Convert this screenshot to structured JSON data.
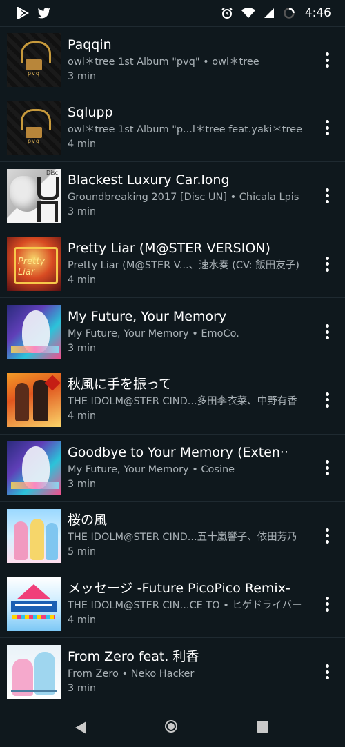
{
  "status_bar": {
    "time": "4:46",
    "left_icons": [
      "play-store-icon",
      "twitter-icon"
    ],
    "right_icons": [
      "alarm-icon",
      "wifi-icon",
      "signal-icon",
      "loading-icon"
    ]
  },
  "tracks": [
    {
      "title": "Paqqin",
      "subtitle": "owl＊tree 1st Album \"pvq\" • owl＊tree",
      "duration": "3 min",
      "art": "owl"
    },
    {
      "title": "Sqlupp",
      "subtitle": "owl＊tree 1st Album \"p...l＊tree feat.yaki＊tree",
      "duration": "4 min",
      "art": "owl"
    },
    {
      "title": "Blackest Luxury Car.long",
      "subtitle": "Groundbreaking 2017 [Disc UN] • Chicala Lpis",
      "duration": "3 min",
      "art": "gb"
    },
    {
      "title": "Pretty Liar (M@STER VERSION)",
      "subtitle": "Pretty Liar (M@STER V...、速水奏 (CV: 飯田友子)",
      "duration": "4 min",
      "art": "pl"
    },
    {
      "title": "My Future, Your Memory",
      "subtitle": "My Future, Your Memory • EmoCo.",
      "duration": "3 min",
      "art": "mf"
    },
    {
      "title": "秋風に手を振って",
      "subtitle": "THE IDOLM@STER CIND...多田李衣菜、中野有香",
      "duration": "4 min",
      "art": "aki"
    },
    {
      "title": "Goodbye to Your Memory (Exten··",
      "subtitle": "My Future, Your Memory • Cosine",
      "duration": "3 min",
      "art": "mf"
    },
    {
      "title": "桜の風",
      "subtitle": "THE IDOLM@STER CIND...五十嵐響子、依田芳乃",
      "duration": "5 min",
      "art": "sak"
    },
    {
      "title": "メッセージ -Future PicoPico Remix-",
      "subtitle": "THE IDOLM@STER CIN...CE TO • ヒゲドライバー",
      "duration": "4 min",
      "art": "cg"
    },
    {
      "title": "From Zero feat. 利香",
      "subtitle": "From Zero • Neko Hacker",
      "duration": "3 min",
      "art": "fz"
    }
  ],
  "art_text": {
    "owl": "pvq",
    "gb_disc": "Disc",
    "pl": "Pretty Liar"
  },
  "nav": {
    "back": "back-icon",
    "home": "home-icon",
    "recent": "recents-icon"
  },
  "colors": {
    "background": "#0f181d",
    "divider": "#1f2a31",
    "subtitle": "#a9b1b6"
  }
}
